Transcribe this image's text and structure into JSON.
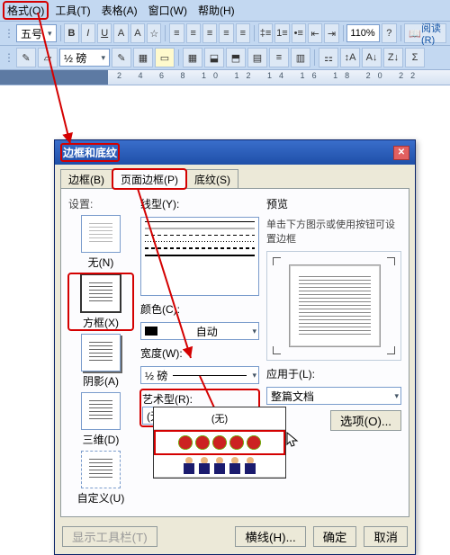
{
  "menubar": {
    "format": "格式(O)",
    "tools": "工具(T)",
    "table": "表格(A)",
    "window": "窗口(W)",
    "help": "帮助(H)"
  },
  "toolbar": {
    "font_size_label": "五号",
    "zoom": "110%",
    "read": "阅读(R)",
    "line_spacing": "½ 磅"
  },
  "dialog": {
    "title": "边框和底纹",
    "tabs": {
      "border": "边框(B)",
      "page_border": "页面边框(P)",
      "shading": "底纹(S)"
    },
    "settings": {
      "group": "设置:",
      "none": "无(N)",
      "box": "方框(X)",
      "shadow": "阴影(A)",
      "threeD": "三维(D)",
      "custom": "自定义(U)"
    },
    "mid": {
      "style": "线型(Y):",
      "color": "颜色(C):",
      "color_val": "自动",
      "width": "宽度(W):",
      "width_val": "½ 磅",
      "art": "艺术型(R):",
      "art_val": "(无)"
    },
    "preview": {
      "group": "预览",
      "hint": "单击下方图示或使用按钮可设置边框",
      "apply_to": "应用于(L):",
      "apply_val": "整篇文档",
      "options": "选项(O)..."
    },
    "foot": {
      "show_toolbar": "显示工具栏(T)",
      "hline": "横线(H)...",
      "ok": "确定",
      "cancel": "取消"
    },
    "art_list": {
      "none": "(无)"
    }
  },
  "ruler": {
    "marks": "2   4   6   8   10  12  14  16  18  20  22"
  }
}
